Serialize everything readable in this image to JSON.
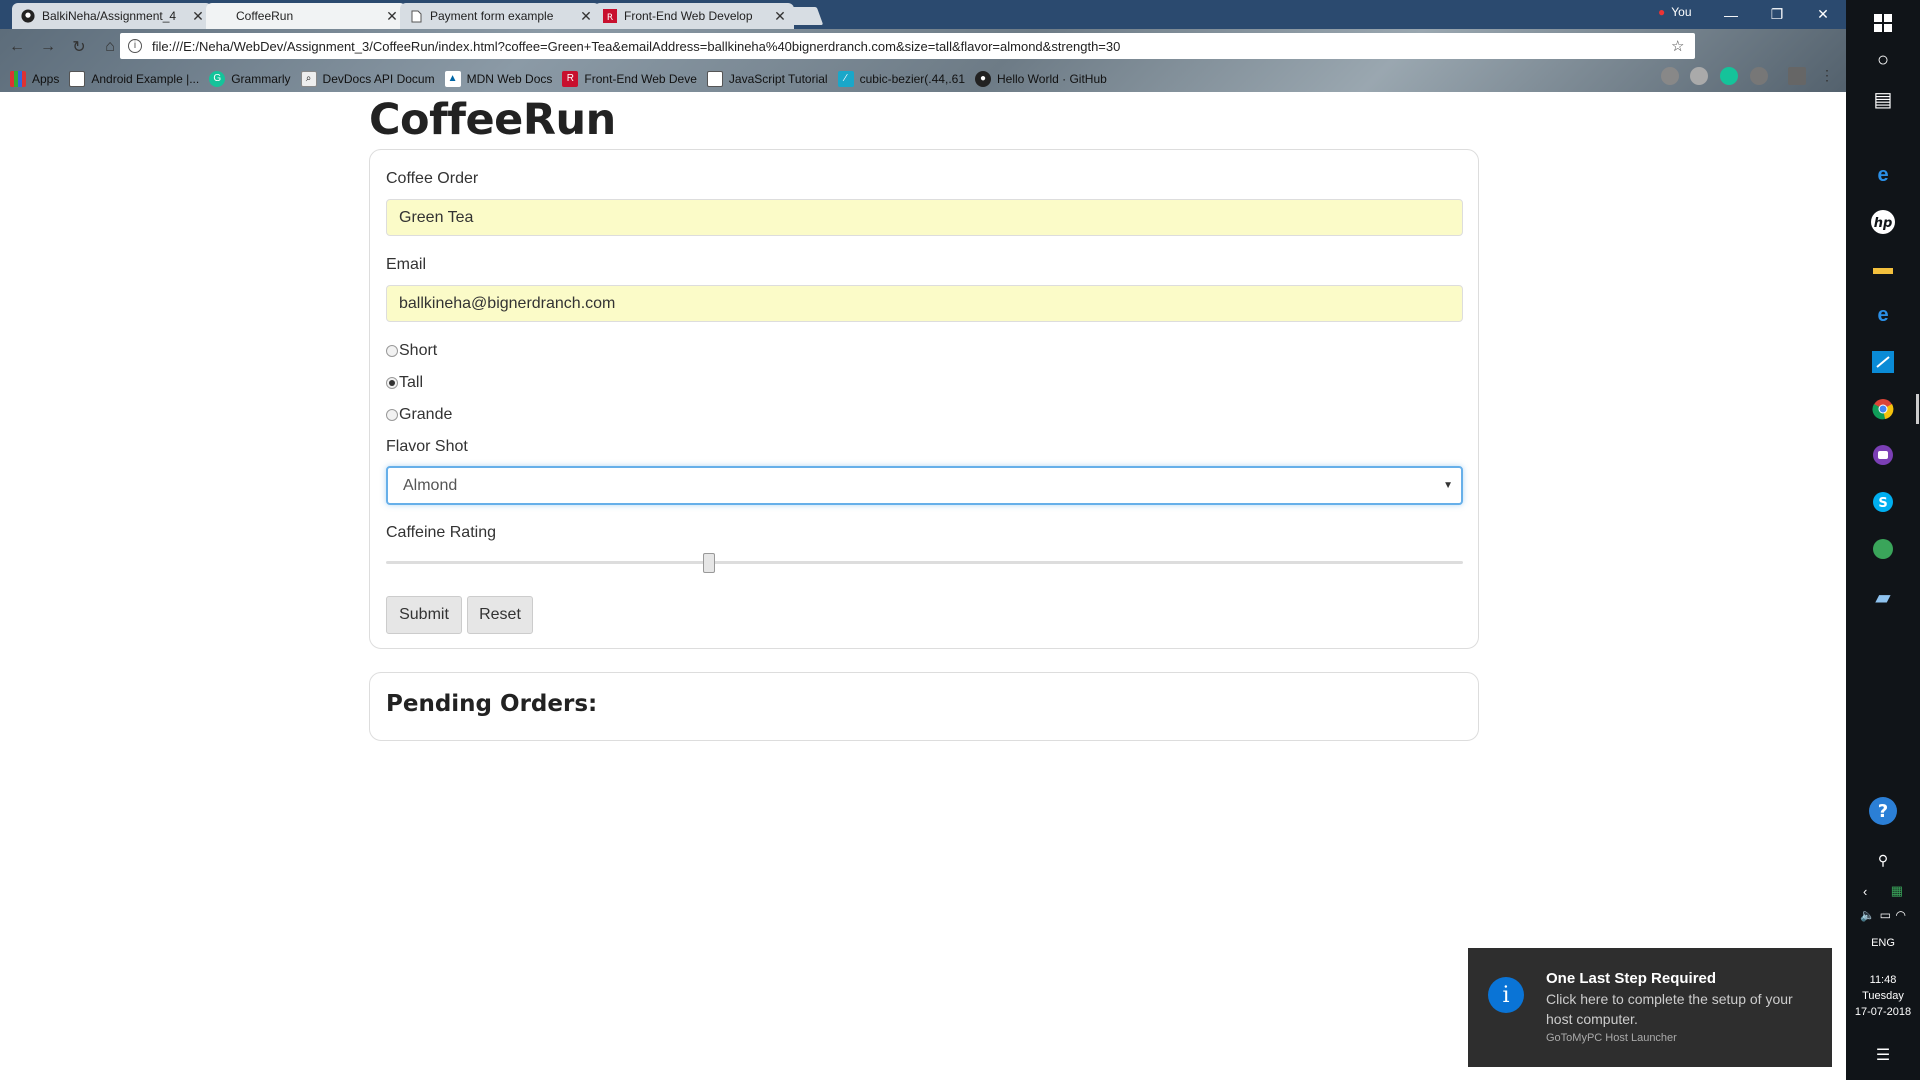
{
  "browser": {
    "tabs": [
      {
        "title": "BalkiNeha/Assignment_4",
        "icon": "github-icon",
        "active": false
      },
      {
        "title": "CoffeeRun",
        "icon": "page-icon",
        "active": true
      },
      {
        "title": "Payment form example",
        "icon": "page-icon",
        "active": false
      },
      {
        "title": "Front-End Web Develop",
        "icon": "bnr-icon",
        "active": false
      }
    ],
    "profile_name": "You",
    "url": "file:///E:/Neha/WebDev/Assignment_3/CoffeeRun/index.html?coffee=Green+Tea&emailAddress=ballkineha%40bignerdranch.com&size=tall&flavor=almond&strength=30",
    "bookmarks": [
      {
        "label": "Apps",
        "icon": "apps-icon"
      },
      {
        "label": "Android Example |...",
        "icon": "page-icon"
      },
      {
        "label": "Grammarly",
        "icon": "grammarly-icon"
      },
      {
        "label": "DevDocs API Docum",
        "icon": "devdocs-icon"
      },
      {
        "label": "MDN Web Docs",
        "icon": "mdn-icon"
      },
      {
        "label": "Front-End Web Deve",
        "icon": "bnr-icon"
      },
      {
        "label": "JavaScript Tutorial",
        "icon": "page-icon"
      },
      {
        "label": "cubic-bezier(.44,.61",
        "icon": "cubic-icon"
      },
      {
        "label": "Hello World · GitHub",
        "icon": "github-icon"
      }
    ]
  },
  "page": {
    "title": "CoffeeRun",
    "form": {
      "coffee_label": "Coffee Order",
      "coffee_value": "Green Tea",
      "email_label": "Email",
      "email_value": "ballkineha@bignerdranch.com",
      "sizes": [
        {
          "label": "Short",
          "checked": false
        },
        {
          "label": "Tall",
          "checked": true
        },
        {
          "label": "Grande",
          "checked": false
        }
      ],
      "flavor_label": "Flavor Shot",
      "flavor_value": "Almond",
      "caffeine_label": "Caffeine Rating",
      "caffeine_value": 30,
      "caffeine_max": 100,
      "submit_label": "Submit",
      "reset_label": "Reset"
    },
    "pending_title": "Pending Orders:"
  },
  "notification": {
    "title": "One Last Step Required",
    "body": "Click here to complete the setup of your host computer.",
    "source": "GoToMyPC Host Launcher"
  },
  "taskbar": {
    "language": "ENG",
    "time": "11:48",
    "day": "Tuesday",
    "date": "17-07-2018"
  },
  "colors": {
    "accent_focus": "#66afe9",
    "input_fill": "#fbfbc8",
    "tab_strip": "#2b4a6f",
    "toast_bg": "#2e2e2e"
  }
}
